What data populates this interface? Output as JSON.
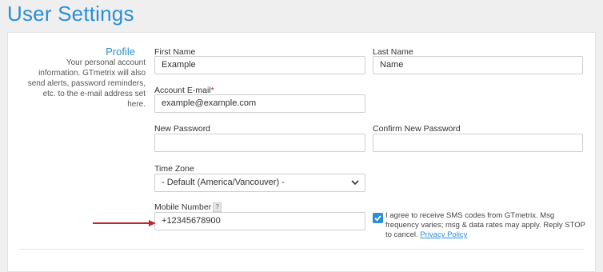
{
  "page": {
    "title": "User Settings"
  },
  "profile": {
    "title": "Profile",
    "description": "Your personal account information. GTmetrix will also send alerts, password reminders, etc. to the e-mail address set here."
  },
  "fields": {
    "first_name": {
      "label": "First Name",
      "value": "Example"
    },
    "last_name": {
      "label": "Last Name",
      "value": "Name"
    },
    "email": {
      "label": "Account E-mail",
      "required_mark": "*",
      "value": "example@example.com"
    },
    "new_password": {
      "label": "New Password",
      "value": ""
    },
    "confirm_password": {
      "label": "Confirm New Password",
      "value": ""
    },
    "time_zone": {
      "label": "Time Zone",
      "value": "- Default (America/Vancouver) -"
    },
    "mobile": {
      "label": "Mobile Number",
      "help": "?",
      "value": "+12345678900"
    }
  },
  "sms_consent": {
    "checked": true,
    "text": "I agree to receive SMS codes from GTmetrix. Msg frequency varies; msg & data rates may apply. Reply STOP to cancel.",
    "link_text": "Privacy Policy"
  },
  "colors": {
    "accent": "#2a8fd6",
    "required": "#c8102e",
    "arrow": "#c0272d"
  },
  "icons": [
    "chevron-down-icon",
    "checkmark-icon",
    "arrow-right-icon",
    "help-icon"
  ]
}
